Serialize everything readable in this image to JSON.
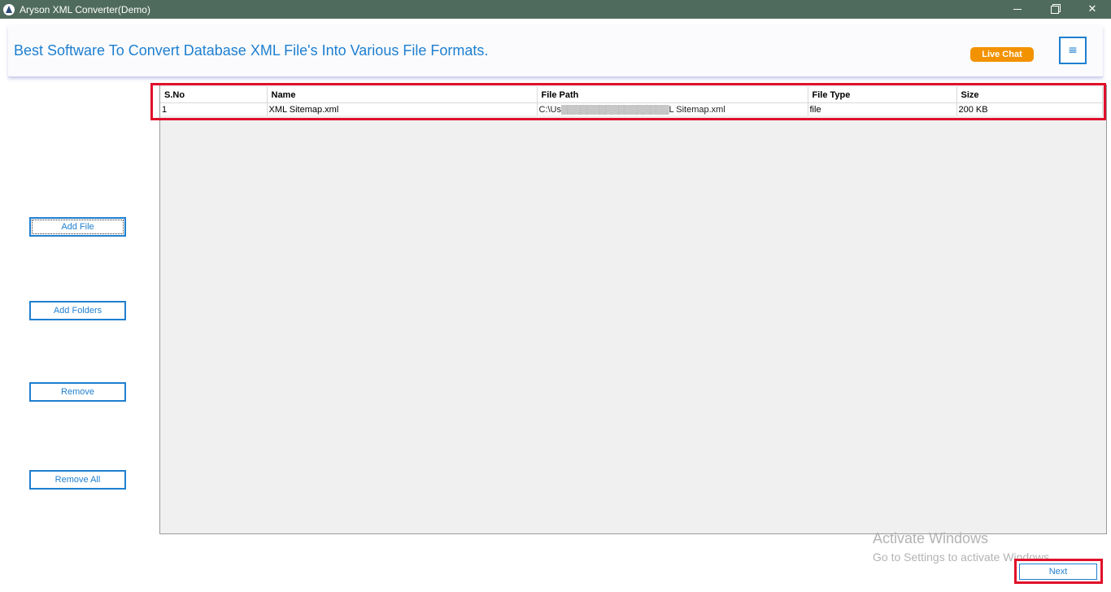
{
  "window": {
    "title": "Aryson XML Converter(Demo)",
    "controls": {
      "close": "✕"
    }
  },
  "header": {
    "tagline": "Best Software To Convert Database XML File's Into Various File Formats.",
    "live_chat_label": "Live Chat",
    "menu_icon": "≡"
  },
  "sidebar": {
    "add_file": "Add File",
    "add_folders": "Add Folders",
    "remove": "Remove",
    "remove_all": "Remove All"
  },
  "table": {
    "columns": [
      "S.No",
      "Name",
      "File Path",
      "File Type",
      "Size"
    ],
    "rows": [
      {
        "sno": "1",
        "name": "XML Sitemap.xml",
        "path": "C:\\Us▒▒▒▒▒▒▒▒▒▒▒▒▒▒▒▒▒L Sitemap.xml",
        "type": "file",
        "size": "200 KB"
      }
    ]
  },
  "watermark": {
    "line1": "Activate Windows",
    "line2": "Go to Settings to activate Windows."
  },
  "footer": {
    "next_label": "Next"
  },
  "colors": {
    "accent": "#1e7fd0",
    "live_chat": "#f39200",
    "titlebar": "#4f6b5e",
    "highlight": "#e0102a"
  }
}
